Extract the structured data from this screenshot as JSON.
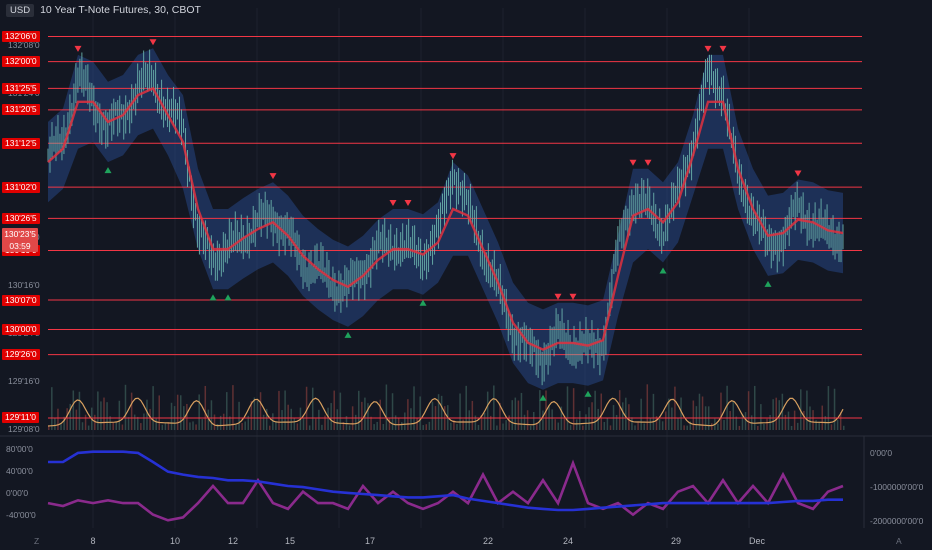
{
  "header": {
    "currency": "USD",
    "symbol_line": "10 Year T-Note Futures, 30, CBOT"
  },
  "current_price": {
    "price": "130'23'5",
    "countdown": "03:59"
  },
  "x_axis_labels": [
    "8",
    "10",
    "12",
    "15",
    "17",
    "22",
    "24",
    "29",
    "Dec"
  ],
  "bottom_corners": {
    "left": "Z",
    "right": "A"
  },
  "colors": {
    "background": "#131722",
    "level_line": "#f23645",
    "level_tag": "#e00000",
    "price_bars": "#6fb8b0",
    "moving_average": "#e0303e",
    "band": "#2a4f9a",
    "sell_marker": "#f23645",
    "buy_marker": "#1fa35c",
    "volume_wave": "#d8a060",
    "blue_line": "#2631d4",
    "purple_line": "#8a2a8c"
  },
  "chart_data": [
    {
      "type": "line",
      "panel": "price",
      "y_axis_labels": [
        "132'08'0",
        "131'24'0",
        "131'16'0",
        "131'08'0",
        "131'00'0",
        "130'16'0",
        "129'24'0",
        "129'16'0",
        "129'08'0"
      ],
      "ylim": [
        129.25,
        132.4
      ],
      "levels": [
        {
          "label": "132'06'0",
          "value": 132.1875
        },
        {
          "label": "132'00'0",
          "value": 132.0
        },
        {
          "label": "131'25'5",
          "value": 131.8
        },
        {
          "label": "131'20'5",
          "value": 131.64
        },
        {
          "label": "131'12'5",
          "value": 131.39
        },
        {
          "label": "131'02'0",
          "value": 131.0625
        },
        {
          "label": "130'26'5",
          "value": 130.83
        },
        {
          "label": "130'19'0",
          "value": 130.59
        },
        {
          "label": "130'07'0",
          "value": 130.22
        },
        {
          "label": "130'00'0",
          "value": 130.0
        },
        {
          "label": "129'26'0",
          "value": 129.8125
        },
        {
          "label": "129'11'0",
          "value": 129.34
        }
      ],
      "x": [
        "7a",
        "7b",
        "8a",
        "8b",
        "9a",
        "9b",
        "10a",
        "10b",
        "11a",
        "11b",
        "12a",
        "12b",
        "13a",
        "14a",
        "14b",
        "15a",
        "15b",
        "16a",
        "16b",
        "17a",
        "17b",
        "18a",
        "18b",
        "19a",
        "19b",
        "20a",
        "20b",
        "21a",
        "21b",
        "22a",
        "22b",
        "23a",
        "23b",
        "24a",
        "24b",
        "25a",
        "25b",
        "26a",
        "26b",
        "27a",
        "27b",
        "28a",
        "28b",
        "29a",
        "29b",
        "30a",
        "30b",
        "Dec1a",
        "Dec1b",
        "Dec2a",
        "Dec2b",
        "Dec3a",
        "Dec3b",
        "Dec4a"
      ],
      "series": [
        {
          "values": [
            131.3,
            131.4,
            131.9,
            131.7,
            131.5,
            131.6,
            131.8,
            131.9,
            131.6,
            131.55,
            130.7,
            130.55,
            130.6,
            130.7,
            130.8,
            130.85,
            130.7,
            130.5,
            130.45,
            130.35,
            130.3,
            130.45,
            130.6,
            130.65,
            130.6,
            130.55,
            130.7,
            131.2,
            130.9,
            130.6,
            130.3,
            130.0,
            129.85,
            129.8,
            129.95,
            129.9,
            129.85,
            129.9,
            130.6,
            131.0,
            130.9,
            130.75,
            131.0,
            131.4,
            131.9,
            131.8,
            131.1,
            130.9,
            130.6,
            130.7,
            130.9,
            130.8,
            130.7,
            130.7
          ]
        },
        {
          "values": [
            131.25,
            131.35,
            131.7,
            131.7,
            131.55,
            131.6,
            131.75,
            131.8,
            131.6,
            131.4,
            130.9,
            130.6,
            130.6,
            130.68,
            130.75,
            130.8,
            130.7,
            130.55,
            130.45,
            130.37,
            130.32,
            130.4,
            130.52,
            130.6,
            130.6,
            130.56,
            130.65,
            130.9,
            130.85,
            130.6,
            130.35,
            130.05,
            129.9,
            129.85,
            129.9,
            129.9,
            129.88,
            129.92,
            130.4,
            130.85,
            130.9,
            130.8,
            130.95,
            131.3,
            131.7,
            131.7,
            131.2,
            130.9,
            130.7,
            130.72,
            130.82,
            130.8,
            130.74,
            130.72
          ]
        },
        {
          "values": [
            131.55,
            131.65,
            132.05,
            132.0,
            131.85,
            131.9,
            132.05,
            132.1,
            131.9,
            131.75,
            131.2,
            130.9,
            130.9,
            130.98,
            131.05,
            131.1,
            131.0,
            130.85,
            130.75,
            130.67,
            130.62,
            130.7,
            130.82,
            130.9,
            130.9,
            130.86,
            130.95,
            131.25,
            131.15,
            130.9,
            130.65,
            130.35,
            130.2,
            130.15,
            130.2,
            130.2,
            130.18,
            130.22,
            130.7,
            131.2,
            131.2,
            131.1,
            131.25,
            131.6,
            132.05,
            132.05,
            131.5,
            131.2,
            131.0,
            131.02,
            131.12,
            131.1,
            131.04,
            131.02
          ]
        },
        {
          "values": [
            130.95,
            131.05,
            131.35,
            131.4,
            131.25,
            131.3,
            131.45,
            131.5,
            131.3,
            131.05,
            130.6,
            130.3,
            130.3,
            130.38,
            130.45,
            130.5,
            130.4,
            130.25,
            130.15,
            130.07,
            130.02,
            130.1,
            130.22,
            130.3,
            130.3,
            130.26,
            130.35,
            130.55,
            130.55,
            130.3,
            130.05,
            129.75,
            129.6,
            129.55,
            129.6,
            129.6,
            129.58,
            129.62,
            130.1,
            130.5,
            130.6,
            130.5,
            130.65,
            131.0,
            131.35,
            131.35,
            130.9,
            130.6,
            130.4,
            130.42,
            130.52,
            130.5,
            130.44,
            130.42
          ]
        }
      ]
    },
    {
      "type": "line",
      "panel": "oscillator",
      "left_axis_labels": [
        "80'00'0",
        "40'00'0",
        "0'00'0",
        "-40'00'0"
      ],
      "right_axis_labels": [
        "0'00'0",
        "-1000000'00'0",
        "-2000000'00'0"
      ],
      "series": [
        {
          "values": [
            62,
            62,
            78,
            80,
            80,
            80,
            78,
            62,
            45,
            40,
            36,
            34,
            30,
            30,
            28,
            24,
            20,
            18,
            14,
            10,
            8,
            6,
            4,
            2,
            0,
            0,
            2,
            4,
            -2,
            -6,
            -10,
            -14,
            -18,
            -20,
            -22,
            -22,
            -20,
            -18,
            -16,
            -14,
            -12,
            -10,
            -10,
            -10,
            -10,
            -10,
            -10,
            -10,
            -10,
            -8,
            -6,
            -6,
            -4,
            -4
          ]
        },
        {
          "values": [
            -10,
            -15,
            -5,
            -10,
            -5,
            -10,
            -10,
            -30,
            -40,
            -35,
            -10,
            20,
            -10,
            -10,
            30,
            -10,
            -20,
            10,
            -10,
            -10,
            -20,
            20,
            -10,
            10,
            -10,
            -20,
            -10,
            10,
            -10,
            40,
            -10,
            10,
            -10,
            30,
            -10,
            60,
            -10,
            -20,
            -10,
            -30,
            -10,
            -20,
            10,
            20,
            -10,
            30,
            -10,
            20,
            -10,
            40,
            -10,
            -20,
            10,
            20
          ]
        }
      ]
    }
  ]
}
